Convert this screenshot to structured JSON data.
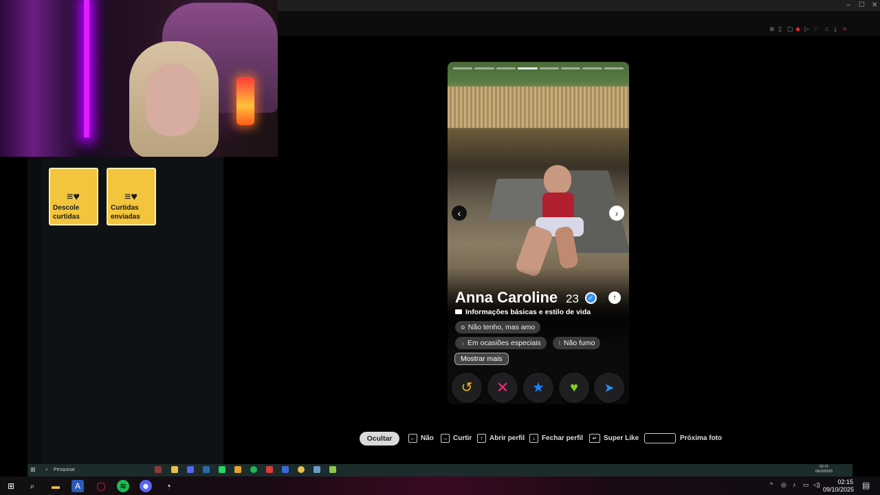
{
  "left_panel": {
    "tiles": [
      {
        "label_line1": "Descole",
        "label_line2": "curtidas"
      },
      {
        "label_line1": "Curtidas",
        "label_line2": "enviadas"
      }
    ]
  },
  "profile": {
    "name": "Anna Caroline",
    "age": "23",
    "info_header": "Informações básicas e estilo de vida",
    "chips": [
      "Não tenho, mas amo",
      "Em ocasiões especiais",
      "Não fumo"
    ],
    "show_more": "Mostrar mais",
    "photo_count": 8,
    "current_photo": 4
  },
  "shortcuts": {
    "hide": "Ocultar",
    "no": "Não",
    "like": "Curtir",
    "open_profile": "Abrir perfil",
    "close_profile": "Fechar perfil",
    "super_like": "Super Like",
    "next_photo": "Próxima foto"
  },
  "inner_taskbar": {
    "search_placeholder": "Pesquisar",
    "time": "02:15",
    "date": "09/10/2025"
  },
  "taskbar": {
    "time": "02:15",
    "date": "09/10/2025"
  },
  "colors": {
    "tile": "#f2c53d",
    "rewind": "#f5b80c",
    "nope": "#fd267a",
    "superlike": "#1786ff",
    "like": "#7ed321",
    "boost": "#2a8cf0"
  }
}
